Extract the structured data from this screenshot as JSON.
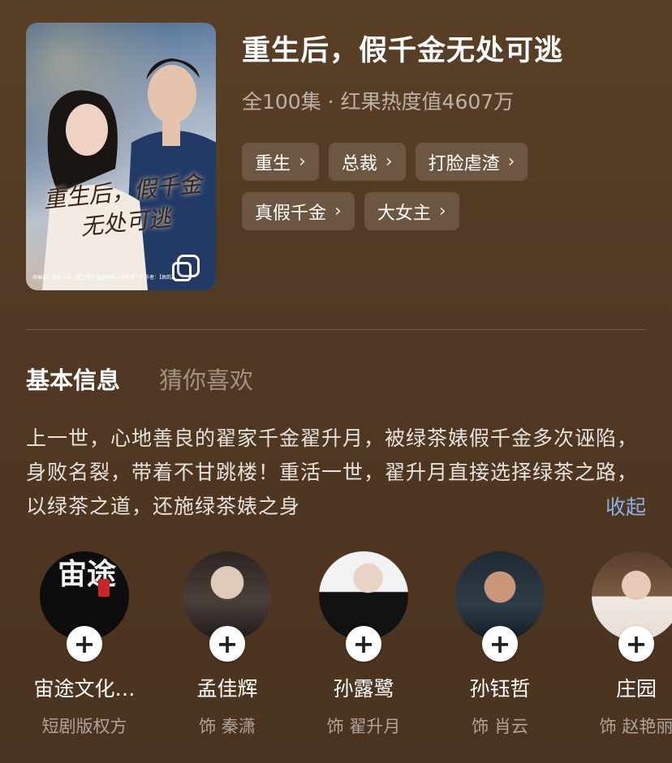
{
  "drama": {
    "title": "重生后，假千金无处可逃",
    "meta": "全100集 · 红果热度值4607万",
    "poster": {
      "title_line1": "重生后，假千金",
      "title_line2": "无处可逃",
      "credit": "改编自：番茄小说《重生真千金重燃家人设逆袭了》作者：【佩韵】"
    },
    "tags": [
      {
        "label": "重生"
      },
      {
        "label": "总裁"
      },
      {
        "label": "打脸虐渣"
      },
      {
        "label": "真假千金"
      },
      {
        "label": "大女主"
      }
    ]
  },
  "tabs": [
    {
      "label": "基本信息",
      "active": true
    },
    {
      "label": "猜你喜欢",
      "active": false
    }
  ],
  "synopsis": {
    "text": "上一世，心地善良的翟家千金翟升月，被绿茶婊假千金多次诬陷，身败名裂，带着不甘跳楼！重活一世，翟升月直接选择绿茶之路，以绿茶之道，还施绿茶婊之身",
    "collapse_label": "收起"
  },
  "cast": [
    {
      "name": "宙途文化…",
      "role": "短剧版权方",
      "avatar_text": "宙途",
      "avatar": "logo"
    },
    {
      "name": "孟佳辉",
      "role": "饰 秦潇",
      "avatar": "person"
    },
    {
      "name": "孙露鹭",
      "role": "饰 翟升月",
      "avatar": "person"
    },
    {
      "name": "孙钰哲",
      "role": "饰 肖云",
      "avatar": "person"
    },
    {
      "name": "庄园",
      "role": "饰 赵艳丽",
      "avatar": "person"
    }
  ],
  "icons": {
    "tag_chevron": "chevron-right-icon",
    "follow": "plus-icon"
  },
  "colors": {
    "accent_link": "#89b2e8",
    "background": "#513822"
  }
}
